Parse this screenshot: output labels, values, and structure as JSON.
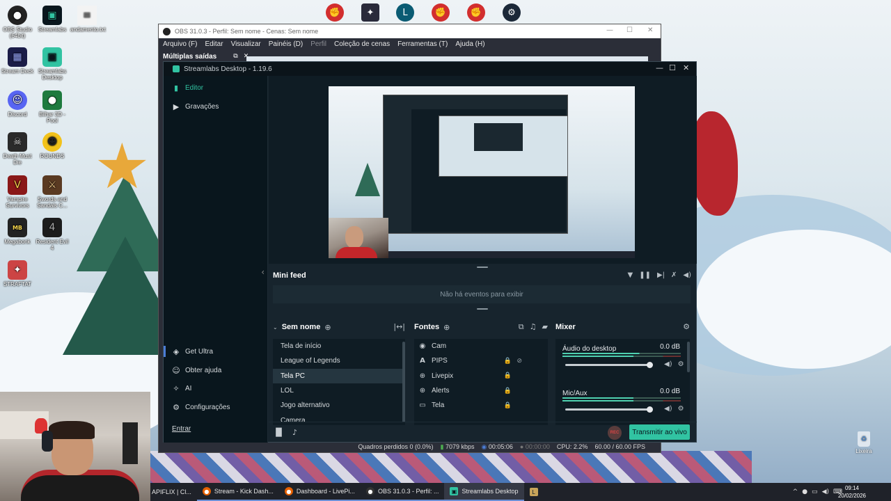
{
  "desktop_icons": [
    {
      "label": "OBS Studio (64bit)",
      "icon": "obs-icon"
    },
    {
      "label": "Streamlabs",
      "icon": "streamlabs-icon"
    },
    {
      "label": "andamento.txt",
      "icon": "text-file-icon"
    },
    {
      "label": "Stream Deck",
      "icon": "stream-deck-icon"
    },
    {
      "label": "Streamlabs Desktop",
      "icon": "streamlabs-desktop-icon"
    },
    {
      "label": "Discord",
      "icon": "discord-icon"
    },
    {
      "label": "Bilhar 3D - Pool",
      "icon": "billiards-icon"
    },
    {
      "label": "Death Must Die",
      "icon": "game-icon"
    },
    {
      "label": "ROUNDS",
      "icon": "game-icon"
    },
    {
      "label": "Vampire Survivors",
      "icon": "game-icon"
    },
    {
      "label": "Swords and Sandals C...",
      "icon": "game-icon"
    },
    {
      "label": "Megabonk",
      "icon": "game-icon"
    },
    {
      "label": "Resident Evil 4",
      "icon": "game-icon"
    },
    {
      "label": "STRAFTAT",
      "icon": "game-icon"
    }
  ],
  "obs": {
    "title": "OBS 31.0.3 - Perfil: Sem nome - Cenas: Sem nome",
    "menu": [
      "Arquivo (F)",
      "Editar",
      "Visualizar",
      "Painéis (D)",
      "Perfil",
      "Coleção de cenas",
      "Ferramentas (T)",
      "Ajuda (H)"
    ],
    "dock_title": "Múltiplas saídas",
    "status": {
      "dropped": "Quadros perdidos 0 (0.0%)",
      "bitrate": "7079 kbps",
      "stream_time": "00:05:06",
      "rec_time": "00:00:00",
      "cpu": "CPU: 2.2%",
      "fps": "60.00 / 60.00 FPS"
    }
  },
  "streamlabs": {
    "title": "Streamlabs Desktop - 1.19.6",
    "nav_top": [
      {
        "label": "Editor",
        "icon": "editor-icon"
      },
      {
        "label": "Gravações",
        "icon": "recordings-icon"
      }
    ],
    "nav_bottom": [
      {
        "label": "Get Ultra",
        "icon": "ultra-icon"
      },
      {
        "label": "Obter ajuda",
        "icon": "help-icon"
      },
      {
        "label": "AI",
        "icon": "ai-icon"
      },
      {
        "label": "Configurações",
        "icon": "settings-icon"
      }
    ],
    "login": "Entrar",
    "mini_feed": {
      "title": "Mini feed",
      "empty": "Não há eventos para exibir"
    },
    "scenes": {
      "title": "Sem nome",
      "items": [
        "Tela de início",
        "League of Legends",
        "Tela PC",
        "LOL",
        "Jogo alternativo",
        "Camera"
      ],
      "selected": "Tela PC"
    },
    "sources": {
      "title": "Fontes",
      "items": [
        {
          "label": "Cam",
          "icon": "webcam-icon"
        },
        {
          "label": "PIPS",
          "icon": "text-icon"
        },
        {
          "label": "Livepix",
          "icon": "globe-icon"
        },
        {
          "label": "Alerts",
          "icon": "globe-icon"
        },
        {
          "label": "Tela",
          "icon": "monitor-icon"
        }
      ]
    },
    "mixer": {
      "title": "Mixer",
      "channels": [
        {
          "name": "Áudio do desktop",
          "db": "0.0 dB",
          "level": 0.65
        },
        {
          "name": "Mic/Aux",
          "db": "0.0 dB",
          "level": 0.6
        }
      ]
    },
    "footer": {
      "rec": "REC",
      "go_live": "Transmitir ao vivo"
    }
  },
  "taskbar": {
    "items": [
      "APIFLIX | Cl...",
      "Stream - Kick Dash...",
      "Dashboard - LivePi...",
      "OBS 31.0.3 - Perfil: ...",
      "Streamlabs Desktop"
    ],
    "time": "09:14",
    "date": "20/02/2026"
  },
  "trash_label": "Lixeira"
}
